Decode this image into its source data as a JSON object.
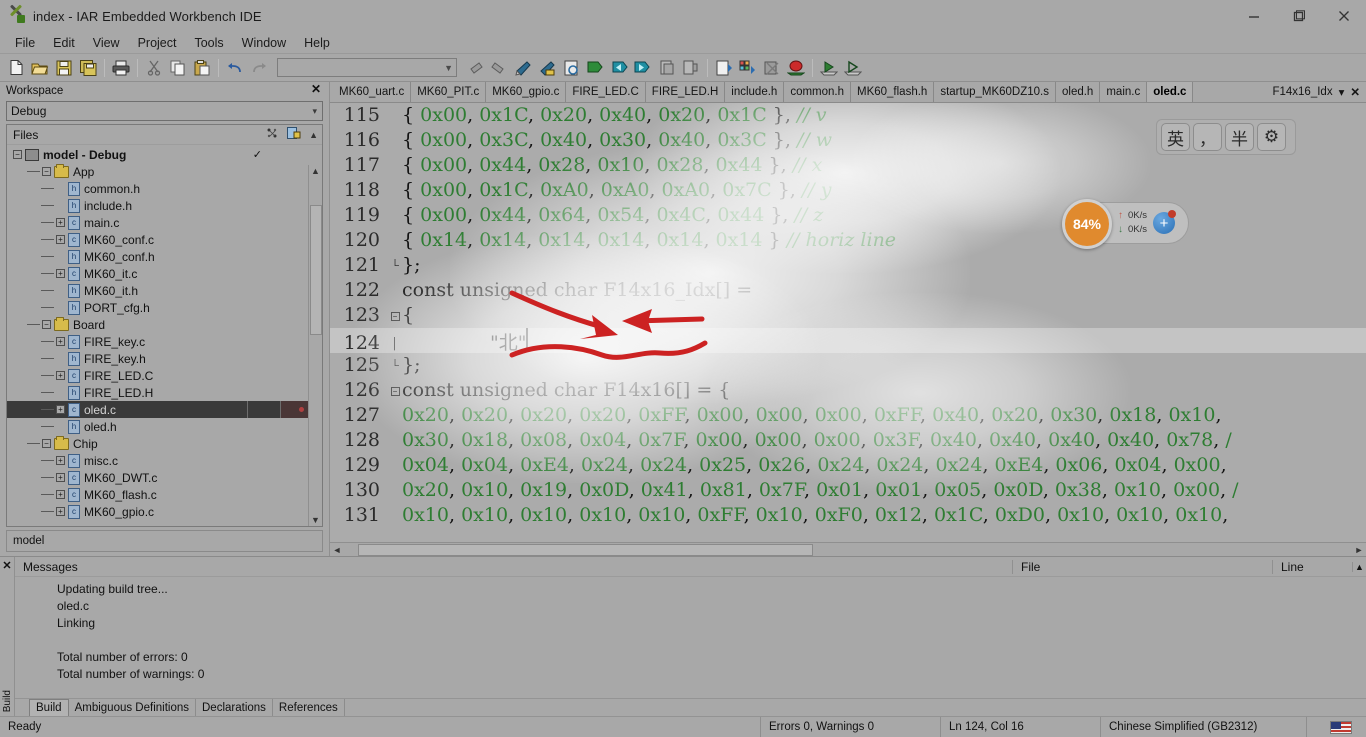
{
  "window": {
    "title": "index - IAR Embedded Workbench IDE",
    "app_icon": "iar-logo-icon",
    "minimize": "—",
    "maximize": "❐",
    "close": "✕"
  },
  "menu": [
    "File",
    "Edit",
    "View",
    "Project",
    "Tools",
    "Window",
    "Help"
  ],
  "toolbar": {
    "icons": [
      "new-document-icon",
      "open-folder-icon",
      "save-icon",
      "save-all-icon",
      "print-icon",
      "cut-icon",
      "copy-icon",
      "paste-icon",
      "undo-icon",
      "redo-icon"
    ],
    "combo_value": "",
    "right_icons": [
      "navigate-back-icon",
      "navigate-forward-icon",
      "go-to-definition-icon",
      "find-in-files-icon",
      "bookmark-toggle-icon",
      "bookmark-next-icon",
      "bookmark-prev-icon",
      "compile-icon",
      "make-icon",
      "stop-build-icon",
      "debug-icon",
      "download-debug-icon",
      "run-icon",
      "step-icon"
    ]
  },
  "workspace": {
    "panel_title": "Workspace",
    "close_label": "✕",
    "config": "Debug",
    "config_chevron": "▾",
    "files_header": "Files",
    "header_icons": [
      "make-all-icon",
      "compile-status-icon",
      "scroll-up-icon"
    ],
    "tree": [
      {
        "label": "model - Debug",
        "depth": 0,
        "type": "project",
        "expand": "−",
        "bold": true,
        "check": "✓"
      },
      {
        "label": "App",
        "depth": 1,
        "type": "folder",
        "expand": "−"
      },
      {
        "label": "common.h",
        "depth": 2,
        "type": "h",
        "expand": ""
      },
      {
        "label": "include.h",
        "depth": 2,
        "type": "h",
        "expand": ""
      },
      {
        "label": "main.c",
        "depth": 2,
        "type": "c",
        "expand": "+"
      },
      {
        "label": "MK60_conf.c",
        "depth": 2,
        "type": "c",
        "expand": "+"
      },
      {
        "label": "MK60_conf.h",
        "depth": 2,
        "type": "h",
        "expand": ""
      },
      {
        "label": "MK60_it.c",
        "depth": 2,
        "type": "c",
        "expand": "+"
      },
      {
        "label": "MK60_it.h",
        "depth": 2,
        "type": "h",
        "expand": ""
      },
      {
        "label": "PORT_cfg.h",
        "depth": 2,
        "type": "h",
        "expand": ""
      },
      {
        "label": "Board",
        "depth": 1,
        "type": "folder",
        "expand": "−"
      },
      {
        "label": "FIRE_key.c",
        "depth": 2,
        "type": "c",
        "expand": "+"
      },
      {
        "label": "FIRE_key.h",
        "depth": 2,
        "type": "h",
        "expand": ""
      },
      {
        "label": "FIRE_LED.C",
        "depth": 2,
        "type": "c",
        "expand": "+"
      },
      {
        "label": "FIRE_LED.H",
        "depth": 2,
        "type": "h",
        "expand": ""
      },
      {
        "label": "oled.c",
        "depth": 2,
        "type": "c",
        "expand": "+",
        "selected": true
      },
      {
        "label": "oled.h",
        "depth": 2,
        "type": "h",
        "expand": ""
      },
      {
        "label": "Chip",
        "depth": 1,
        "type": "folder",
        "expand": "−"
      },
      {
        "label": "misc.c",
        "depth": 2,
        "type": "c",
        "expand": "+"
      },
      {
        "label": "MK60_DWT.c",
        "depth": 2,
        "type": "c",
        "expand": "+"
      },
      {
        "label": "MK60_flash.c",
        "depth": 2,
        "type": "c",
        "expand": "+"
      },
      {
        "label": "MK60_gpio.c",
        "depth": 2,
        "type": "c",
        "expand": "+"
      }
    ],
    "footer_tab": "model"
  },
  "editor": {
    "tabs": [
      {
        "label": "MK60_uart.c",
        "active": false
      },
      {
        "label": "MK60_PIT.c",
        "active": false
      },
      {
        "label": "MK60_gpio.c",
        "active": false
      },
      {
        "label": "FIRE_LED.C",
        "active": false
      },
      {
        "label": "FIRE_LED.H",
        "active": false
      },
      {
        "label": "include.h",
        "active": false
      },
      {
        "label": "common.h",
        "active": false
      },
      {
        "label": "MK60_flash.h",
        "active": false
      },
      {
        "label": "startup_MK60DZ10.s",
        "active": false
      },
      {
        "label": "oled.h",
        "active": false
      },
      {
        "label": "main.c",
        "active": false
      },
      {
        "label": "oled.c",
        "active": true
      }
    ],
    "symbol_nav": "F14x16_Idx",
    "symbol_chevron": "▾",
    "symbol_close": "✕",
    "lines": [
      {
        "num": "115",
        "fold": "",
        "code": "{ 0x00, 0x1C, 0x20, 0x40, 0x20, 0x1C }, // v",
        "kind": "hexrow"
      },
      {
        "num": "116",
        "fold": "",
        "code": "{ 0x00, 0x3C, 0x40, 0x30, 0x40, 0x3C }, // w",
        "kind": "hexrow"
      },
      {
        "num": "117",
        "fold": "",
        "code": "{ 0x00, 0x44, 0x28, 0x10, 0x28, 0x44 }, // x",
        "kind": "hexrow"
      },
      {
        "num": "118",
        "fold": "",
        "code": "{ 0x00, 0x1C, 0xA0, 0xA0, 0xA0, 0x7C }, // y",
        "kind": "hexrow"
      },
      {
        "num": "119",
        "fold": "",
        "code": "{ 0x00, 0x44, 0x64, 0x54, 0x4C, 0x44 }, // z",
        "kind": "hexrow"
      },
      {
        "num": "120",
        "fold": "",
        "code": "{ 0x14, 0x14, 0x14, 0x14, 0x14, 0x14 } // horiz line",
        "kind": "hexrow"
      },
      {
        "num": "121",
        "fold": "└",
        "code": "};",
        "kind": "plain"
      },
      {
        "num": "122",
        "fold": "",
        "code": "const unsigned char F14x16_Idx[] =",
        "kind": "plain"
      },
      {
        "num": "123",
        "fold": "−",
        "code": "{",
        "kind": "plain"
      },
      {
        "num": "124",
        "fold": "│",
        "code": "\"北\"",
        "kind": "current",
        "indent": 8
      },
      {
        "num": "125",
        "fold": "└",
        "code": "};",
        "kind": "plain"
      },
      {
        "num": "126",
        "fold": "−",
        "code": "const unsigned char F14x16[] = {",
        "kind": "plain"
      },
      {
        "num": "127",
        "fold": "",
        "code": "0x20, 0x20, 0x20, 0x20, 0xFF, 0x00, 0x00, 0x00, 0xFF, 0x40, 0x20, 0x30, 0x18, 0x10,",
        "kind": "hex"
      },
      {
        "num": "128",
        "fold": "",
        "code": "0x30, 0x18, 0x08, 0x04, 0x7F, 0x00, 0x00, 0x00, 0x3F, 0x40, 0x40, 0x40, 0x40, 0x78, /",
        "kind": "hex"
      },
      {
        "num": "129",
        "fold": "",
        "code": "0x04, 0x04, 0xE4, 0x24, 0x24, 0x25, 0x26, 0x24, 0x24, 0x24, 0xE4, 0x06, 0x04, 0x00,",
        "kind": "hex"
      },
      {
        "num": "130",
        "fold": "",
        "code": "0x20, 0x10, 0x19, 0x0D, 0x41, 0x81, 0x7F, 0x01, 0x01, 0x05, 0x0D, 0x38, 0x10, 0x00, /",
        "kind": "hex"
      },
      {
        "num": "131",
        "fold": "",
        "code": "0x10, 0x10, 0x10, 0x10, 0x10, 0xFF, 0x10, 0xF0, 0x12, 0x1C, 0xD0, 0x10, 0x10, 0x10,",
        "kind": "hex"
      }
    ],
    "scroll_left_arrow": "◄",
    "scroll_right_arrow": "►"
  },
  "ime": {
    "keys": [
      "英",
      "，",
      "半",
      "⚙"
    ],
    "key_names": [
      "ime-language-english",
      "ime-punctuation",
      "ime-halfwidth",
      "ime-settings-gear"
    ]
  },
  "net_widget": {
    "percent": "84%",
    "up_rate": "0K/s",
    "down_rate": "0K/s",
    "up_arrow": "↑",
    "down_arrow": "↓",
    "plus": "+"
  },
  "messages": {
    "columns": {
      "message": "Messages",
      "file": "File",
      "line": "Line"
    },
    "rows": [
      "Updating build tree...",
      "oled.c",
      "Linking",
      "",
      "Total number of errors: 0",
      "Total number of warnings: 0"
    ],
    "side_label": "Build",
    "close": "✕",
    "tabs": [
      {
        "label": "Build",
        "active": true
      },
      {
        "label": "Ambiguous Definitions",
        "active": false
      },
      {
        "label": "Declarations",
        "active": false
      },
      {
        "label": "References",
        "active": false
      }
    ]
  },
  "status": {
    "ready": "Ready",
    "errors_warnings": "Errors 0, Warnings 0",
    "cursor": "Ln 124, Col 16",
    "encoding": "Chinese Simplified (GB2312)",
    "flag": "us-flag-icon"
  },
  "colors": {
    "chrome": "#a8a8a8",
    "comment_green": "#2e7d32",
    "selection": "#3a3a3a",
    "annotation_red": "#cc2222",
    "accent_orange": "#e08a2e"
  }
}
